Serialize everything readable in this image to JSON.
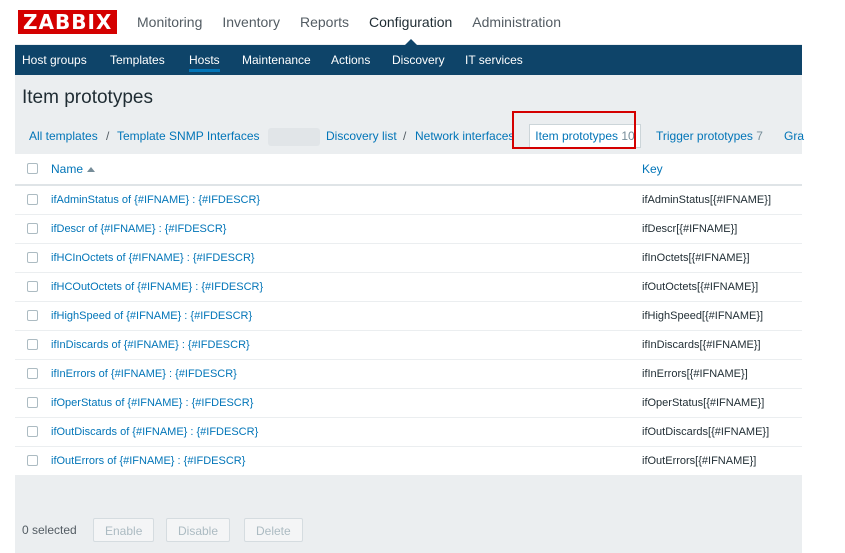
{
  "brand": {
    "logo": "ZABBIX"
  },
  "main_nav": [
    {
      "label": "Monitoring"
    },
    {
      "label": "Inventory"
    },
    {
      "label": "Reports"
    },
    {
      "label": "Configuration",
      "active": true
    },
    {
      "label": "Administration"
    }
  ],
  "sub_nav": [
    {
      "label": "Host groups"
    },
    {
      "label": "Templates"
    },
    {
      "label": "Hosts",
      "active": true
    },
    {
      "label": "Maintenance"
    },
    {
      "label": "Actions"
    },
    {
      "label": "Discovery"
    },
    {
      "label": "IT services"
    }
  ],
  "page": {
    "title": "Item prototypes"
  },
  "breadcrumb": {
    "all_templates": "All templates",
    "template": "Template SNMP Interfaces",
    "discovery_list": "Discovery list",
    "discovery_rule": "Network interfaces",
    "item_prototypes": {
      "label": "Item prototypes",
      "count": "10"
    },
    "trigger_prototypes": {
      "label": "Trigger prototypes",
      "count": "7"
    },
    "graph_prototypes_partial": "Gra",
    "separator": "/"
  },
  "table": {
    "headers": {
      "name": "Name",
      "key": "Key"
    },
    "rows": [
      {
        "name": "ifAdminStatus of {#IFNAME} : {#IFDESCR}",
        "key": "ifAdminStatus[{#IFNAME}]"
      },
      {
        "name": "ifDescr of {#IFNAME} : {#IFDESCR}",
        "key": "ifDescr[{#IFNAME}]"
      },
      {
        "name": "ifHCInOctets of {#IFNAME} : {#IFDESCR}",
        "key": "ifInOctets[{#IFNAME}]"
      },
      {
        "name": "ifHCOutOctets of {#IFNAME} : {#IFDESCR}",
        "key": "ifOutOctets[{#IFNAME}]"
      },
      {
        "name": "ifHighSpeed of {#IFNAME} : {#IFDESCR}",
        "key": "ifHighSpeed[{#IFNAME}]"
      },
      {
        "name": "ifInDiscards of {#IFNAME} : {#IFDESCR}",
        "key": "ifInDiscards[{#IFNAME}]"
      },
      {
        "name": "ifInErrors of {#IFNAME} : {#IFDESCR}",
        "key": "ifInErrors[{#IFNAME}]"
      },
      {
        "name": "ifOperStatus of {#IFNAME} : {#IFDESCR}",
        "key": "ifOperStatus[{#IFNAME}]"
      },
      {
        "name": "ifOutDiscards of {#IFNAME} : {#IFDESCR}",
        "key": "ifOutDiscards[{#IFNAME}]"
      },
      {
        "name": "ifOutErrors of {#IFNAME} : {#IFDESCR}",
        "key": "ifOutErrors[{#IFNAME}]"
      }
    ]
  },
  "footer": {
    "selected_text": "0 selected",
    "buttons": {
      "enable": "Enable",
      "disable": "Disable",
      "delete": "Delete"
    }
  },
  "colors": {
    "logo_red": "#d40000",
    "nav_blue": "#0e4469",
    "link_blue": "#0275b8",
    "highlight": "#d40000"
  }
}
